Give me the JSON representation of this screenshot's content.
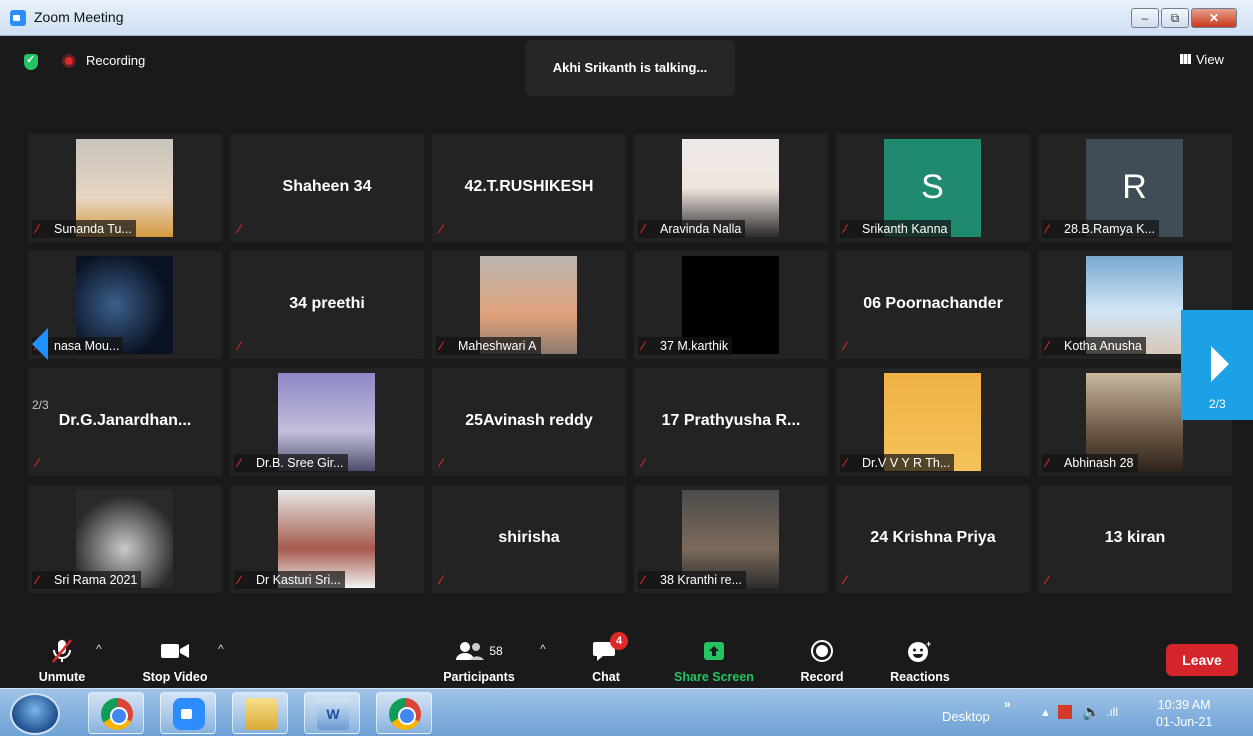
{
  "window": {
    "title": "Zoom Meeting",
    "minimize_symbol": "–",
    "maximize_symbol": "⧉",
    "close_symbol": "✕"
  },
  "top_bar": {
    "security_icon": "shield-check-icon",
    "recording_label": "Recording",
    "talking_text": "Akhi Srikanth is talking...",
    "view_label": "View"
  },
  "pager": {
    "left_page": "2/3",
    "right_page": "2/3"
  },
  "tiles": [
    {
      "name": "Sunanda Tu...",
      "big": "",
      "photo": "ph-a"
    },
    {
      "name": "",
      "big": "Shaheen 34",
      "photo": ""
    },
    {
      "name": "",
      "big": "42.T.RUSHIKESH",
      "photo": ""
    },
    {
      "name": "Aravinda Nalla",
      "big": "",
      "photo": "ph-b"
    },
    {
      "name": "Srikanth Kanna",
      "big": "",
      "avatar": "S",
      "avatar_color": "#1f8a70"
    },
    {
      "name": "28.B.Ramya K...",
      "big": "",
      "avatar": "R",
      "avatar_color": "#3e4d56"
    },
    {
      "name": "nasa Mou...",
      "big": "",
      "photo": "ph-c"
    },
    {
      "name": "",
      "big": "34 preethi",
      "photo": ""
    },
    {
      "name": "Maheshwari A",
      "big": "",
      "photo": "ph-d"
    },
    {
      "name": "37 M.karthik",
      "big": "",
      "photo": "ph-e"
    },
    {
      "name": "",
      "big": "06 Poornachander",
      "photo": ""
    },
    {
      "name": "Kotha Anusha",
      "big": "",
      "photo": "ph-f"
    },
    {
      "name": "",
      "big": "Dr.G.Janardhan...",
      "photo": ""
    },
    {
      "name": "Dr.B. Sree Gir...",
      "big": "",
      "photo": "ph-g"
    },
    {
      "name": "",
      "big": "25Avinash reddy",
      "photo": ""
    },
    {
      "name": "",
      "big": "17 Prathyusha R...",
      "photo": ""
    },
    {
      "name": "Dr.V V Y R Th...",
      "big": "",
      "photo": "ph-h"
    },
    {
      "name": "Abhinash 28",
      "big": "",
      "photo": "ph-i"
    },
    {
      "name": "Sri Rama 2021",
      "big": "",
      "photo": "ph-j"
    },
    {
      "name": "Dr Kasturi Sri...",
      "big": "",
      "photo": "ph-k"
    },
    {
      "name": "",
      "big": "shirisha",
      "photo": ""
    },
    {
      "name": "38 Kranthi re...",
      "big": "",
      "photo": "ph-l"
    },
    {
      "name": "",
      "big": "24 Krishna Priya",
      "photo": ""
    },
    {
      "name": "",
      "big": "13 kiran",
      "photo": ""
    }
  ],
  "controls": {
    "unmute": "Unmute",
    "stop_video": "Stop Video",
    "participants": "Participants",
    "participants_count": "58",
    "chat": "Chat",
    "chat_badge": "4",
    "share_screen": "Share Screen",
    "record": "Record",
    "reactions": "Reactions",
    "leave": "Leave",
    "caret": "^",
    "share_color": "#23c461",
    "leave_color": "#d4252a"
  },
  "taskbar": {
    "word_glyph": "W",
    "desktop_label": "Desktop",
    "chevron": "»",
    "up_arrow": "▲",
    "speaker": "🔈",
    "signal": ".ıll",
    "time": "10:39 AM",
    "date": "01-Jun-21"
  }
}
